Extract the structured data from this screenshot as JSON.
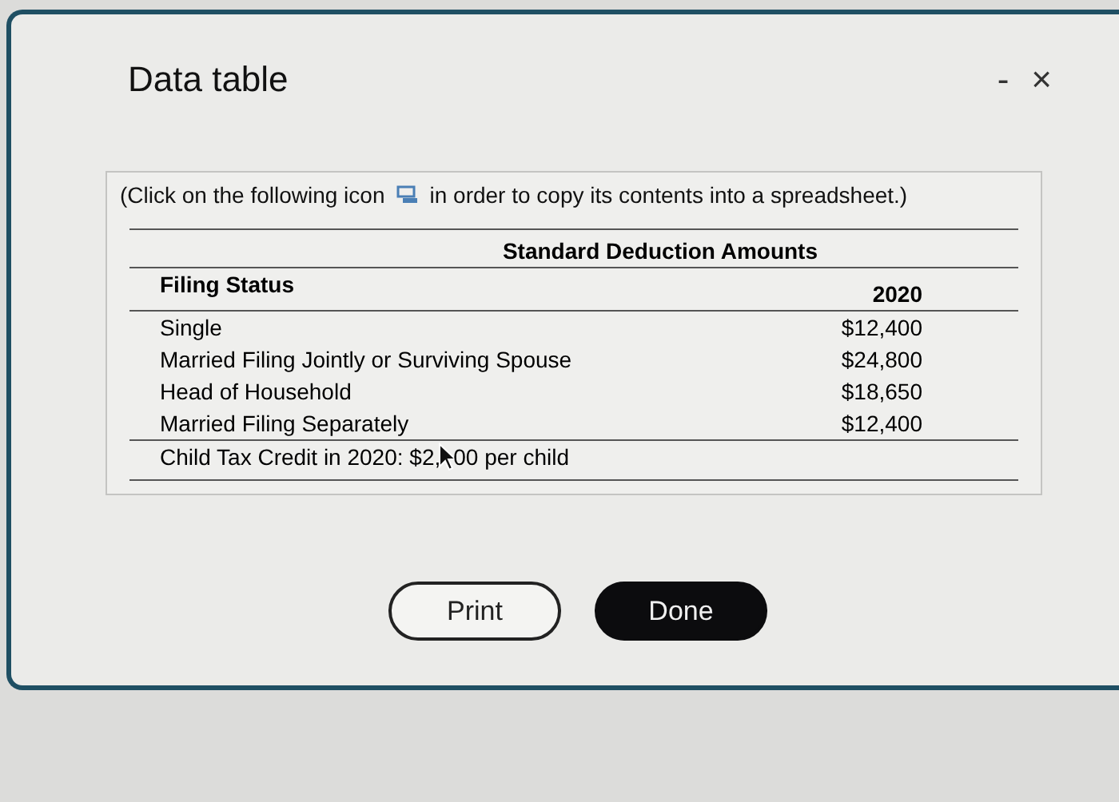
{
  "window": {
    "title": "Data table",
    "controls": [
      "-",
      "×"
    ]
  },
  "instruction": {
    "before": "(Click on the following icon",
    "after": "in order to copy its contents into a spreadsheet.)"
  },
  "table": {
    "caption": "Standard Deduction Amounts",
    "columns": [
      "Filing Status",
      "2020"
    ],
    "rows": [
      [
        "Single",
        "$12,400"
      ],
      [
        "Married Filing Jointly or Surviving Spouse",
        "$24,800"
      ],
      [
        "Head of Household",
        "$18,650"
      ],
      [
        "Married Filing Separately",
        "$12,400"
      ]
    ],
    "footnote": {
      "before": "Child Tax Credit in 2020: $2,",
      "after": "00 per child"
    }
  },
  "buttons": [
    {
      "label": "Print",
      "kind": "outline"
    },
    {
      "label": "Done",
      "kind": "primary"
    }
  ]
}
